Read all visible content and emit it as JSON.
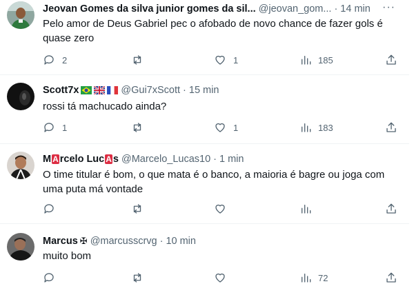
{
  "tweets": [
    {
      "name": "Jeovan Gomes da silva junior gomes da sil...",
      "handle": "@jeovan_gom...",
      "time": "14 min",
      "text": "Pelo amor de Deus Gabriel pec o afobado de novo chance de fazer gols é quase zero",
      "replies": "2",
      "retweets": "",
      "likes": "1",
      "views": "185"
    },
    {
      "name": "Scott7x",
      "handle": "@Gui7xScott",
      "time": "15 min",
      "text": "rossi tá machucado ainda?",
      "replies": "1",
      "retweets": "",
      "likes": "1",
      "views": "183",
      "flags": [
        "brazil-flag",
        "uk-flag",
        "france-flag"
      ]
    },
    {
      "name_parts": [
        "M",
        "A",
        "rcelo Luc",
        "A",
        "s"
      ],
      "handle": "@Marcelo_Lucas10",
      "time": "1 min",
      "text": "O time titular é bom, o que mata é o banco, a maioria é bagre ou joga com uma puta má vontade",
      "replies": "",
      "retweets": "",
      "likes": "",
      "views": ""
    },
    {
      "name": "Marcus",
      "name_badge": "✠",
      "handle": "@marcusscrvg",
      "time": "10 min",
      "text": "muito bom",
      "replies": "",
      "retweets": "",
      "likes": "",
      "views": "72"
    }
  ],
  "separator": "·",
  "icons": {
    "reply": "reply-icon",
    "retweet": "retweet-icon",
    "like": "heart-icon",
    "views": "views-bar-chart-icon",
    "share": "share-icon",
    "more": "more-dots-icon"
  },
  "colors": {
    "text": "#0f1419",
    "muted": "#536471",
    "divider": "#eff3f4",
    "name_box_red": "#dd2e44"
  }
}
